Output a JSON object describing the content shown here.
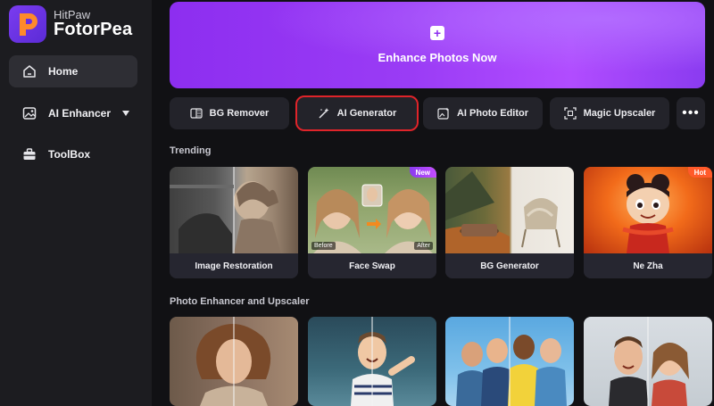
{
  "app": {
    "brand_sub": "HitPaw",
    "brand_main": "FotorPea"
  },
  "sidebar": {
    "items": [
      {
        "label": "Home",
        "icon": "home-icon",
        "active": true
      },
      {
        "label": "AI Enhancer",
        "icon": "image-enhance-icon",
        "active": false
      },
      {
        "label": "ToolBox",
        "icon": "toolbox-icon",
        "active": false
      }
    ]
  },
  "hero": {
    "label": "Enhance Photos Now"
  },
  "tools": [
    {
      "label": "BG Remover",
      "icon": "bg-remover-icon"
    },
    {
      "label": "AI Generator",
      "icon": "magic-wand-icon",
      "selected": true
    },
    {
      "label": "AI Photo Editor",
      "icon": "photo-edit-icon"
    },
    {
      "label": "Magic Upscaler",
      "icon": "upscale-icon"
    }
  ],
  "more_label": "•••",
  "trending": {
    "title": "Trending",
    "cards": [
      {
        "label": "Image Restoration"
      },
      {
        "label": "Face Swap",
        "badge": "New",
        "before": "Before",
        "after": "After"
      },
      {
        "label": "BG Generator"
      },
      {
        "label": "Ne Zha",
        "badge": "Hot"
      }
    ]
  },
  "enhancer": {
    "title": "Photo Enhancer and Upscaler"
  },
  "colors": {
    "accent": "#9a3cf5",
    "selected_outline": "#e0242a",
    "hot_badge": "#ff5a2a"
  }
}
